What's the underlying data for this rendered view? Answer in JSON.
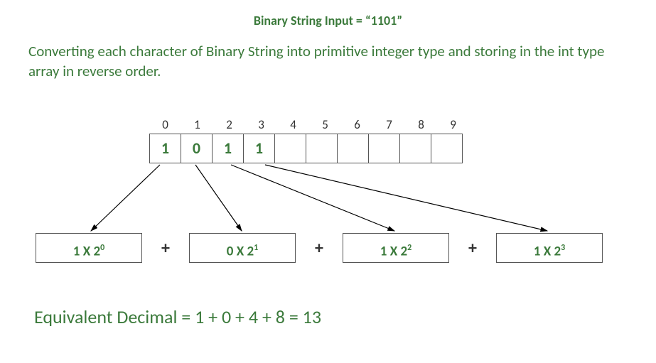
{
  "title": "Binary String Input = “1101”",
  "description": "Converting each character of Binary String into primitive integer type and storing in the int type array in reverse order.",
  "indices": [
    "0",
    "1",
    "2",
    "3",
    "4",
    "5",
    "6",
    "7",
    "8",
    "9"
  ],
  "cells": [
    "1",
    "0",
    "1",
    "1",
    "",
    "",
    "",
    "",
    "",
    ""
  ],
  "terms_base": [
    "1 X 2",
    "0 X 2",
    "1 X 2",
    "1 X 2"
  ],
  "terms_exp": [
    "0",
    "1",
    "2",
    "3"
  ],
  "plus": "+",
  "result": "Equivalent Decimal = 1 + 0 + 4 + 8 = 13"
}
